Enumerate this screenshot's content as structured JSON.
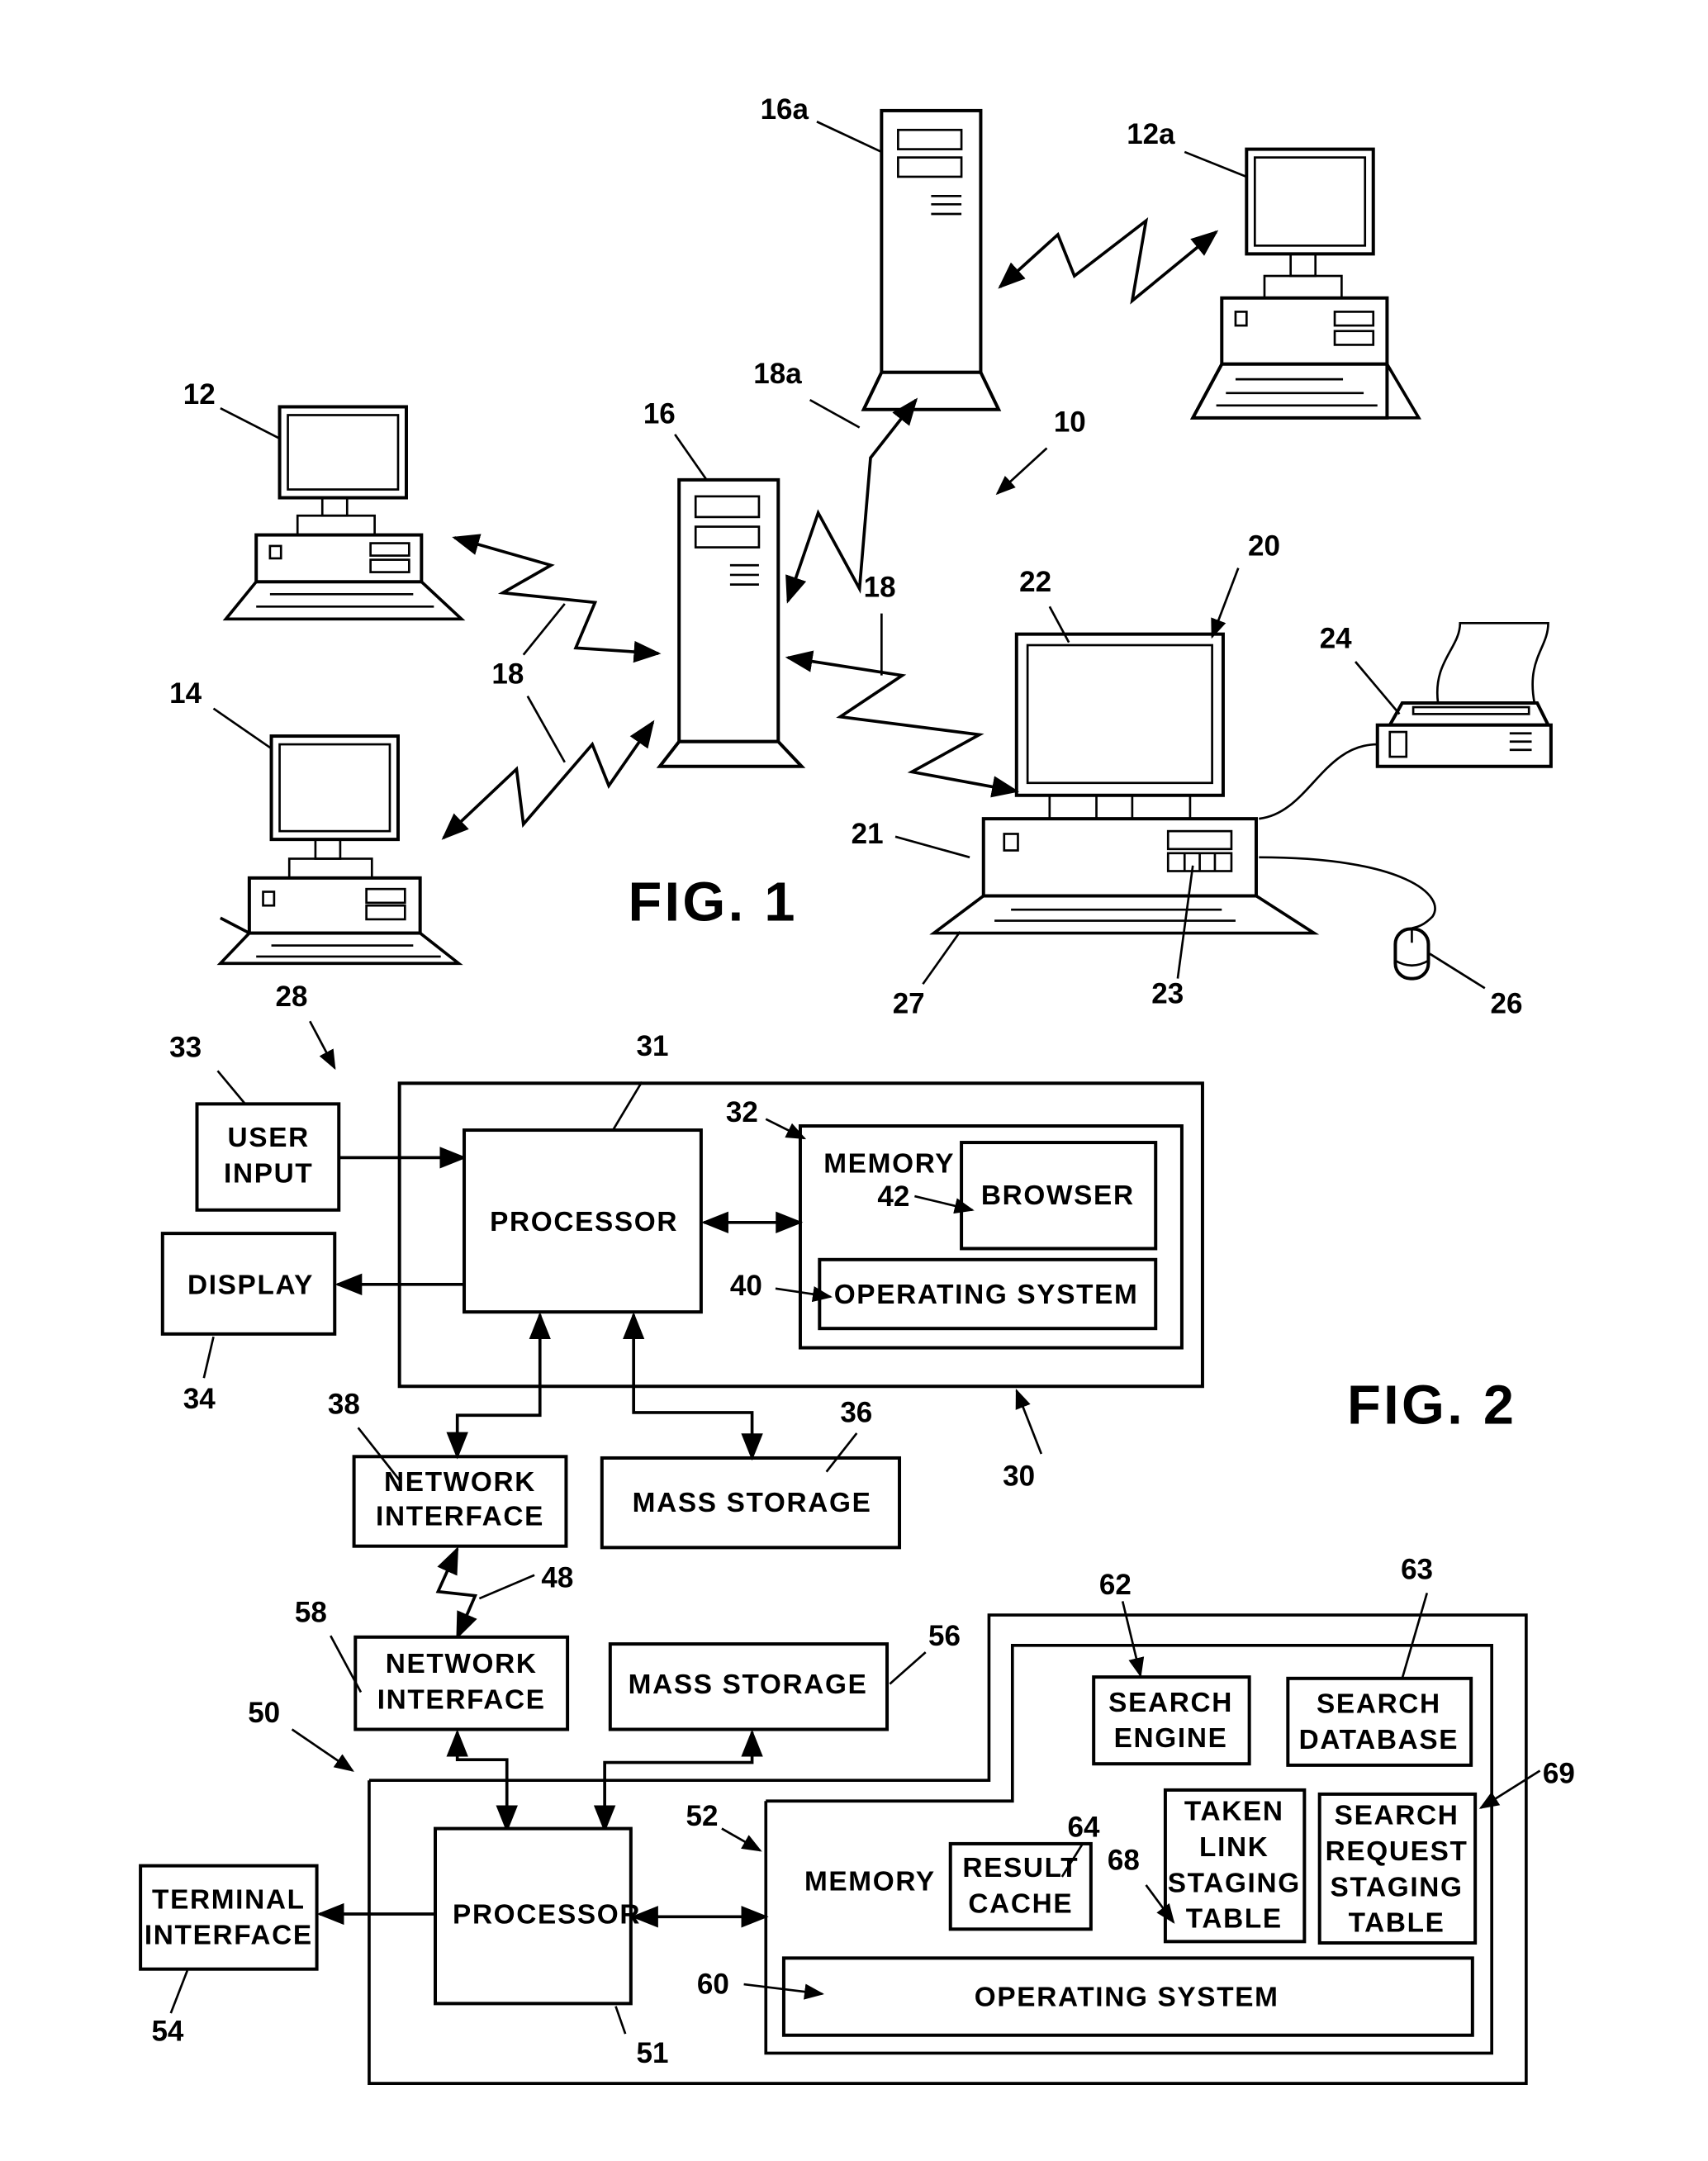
{
  "fig1": {
    "caption": "FIG. 1",
    "refs": {
      "network": "10",
      "client_12": "12",
      "client_12a": "12a",
      "client_14": "14",
      "server_16": "16",
      "server_16a": "16a",
      "link_18_a": "18",
      "link_18_b": "18",
      "link_18_c": "18",
      "link_18a": "18a",
      "computer_20": "20",
      "system_unit_21": "21",
      "monitor_22": "22",
      "drive_23": "23",
      "printer_24": "24",
      "mouse_26": "26",
      "keyboard_27": "27"
    }
  },
  "fig2": {
    "caption": "FIG. 2",
    "client": {
      "refs": {
        "client_system": "28",
        "computer": "30",
        "processor": "31",
        "memory": "32",
        "user_input": "33",
        "display": "34",
        "mass_storage": "36",
        "network_interface": "38",
        "operating_system": "40",
        "browser": "42"
      },
      "labels": {
        "user_input": [
          "USER",
          "INPUT"
        ],
        "display": "DISPLAY",
        "processor": "PROCESSOR",
        "memory": "MEMORY",
        "browser": "BROWSER",
        "operating_system": "OPERATING SYSTEM",
        "network_interface": [
          "NETWORK",
          "INTERFACE"
        ],
        "mass_storage": "MASS STORAGE"
      }
    },
    "network_link_ref": "48",
    "server": {
      "refs": {
        "server_system": "50",
        "processor": "51",
        "memory": "52",
        "terminal_interface": "54",
        "mass_storage": "56",
        "network_interface": "58",
        "operating_system": "60",
        "search_engine": "62",
        "search_database": "63",
        "result_cache": "64",
        "taken_link_staging_table": "68",
        "search_request_staging_table": "69"
      },
      "labels": {
        "network_interface": [
          "NETWORK",
          "INTERFACE"
        ],
        "mass_storage": "MASS STORAGE",
        "terminal_interface": [
          "TERMINAL",
          "INTERFACE"
        ],
        "processor": "PROCESSOR",
        "memory": "MEMORY",
        "search_engine": [
          "SEARCH",
          "ENGINE"
        ],
        "search_database": [
          "SEARCH",
          "DATABASE"
        ],
        "result_cache": [
          "RESULT",
          "CACHE"
        ],
        "taken_link_staging_table": [
          "TAKEN",
          "LINK",
          "STAGING",
          "TABLE"
        ],
        "search_request_staging_table": [
          "SEARCH",
          "REQUEST",
          "STAGING",
          "TABLE"
        ],
        "operating_system": "OPERATING SYSTEM"
      }
    }
  }
}
